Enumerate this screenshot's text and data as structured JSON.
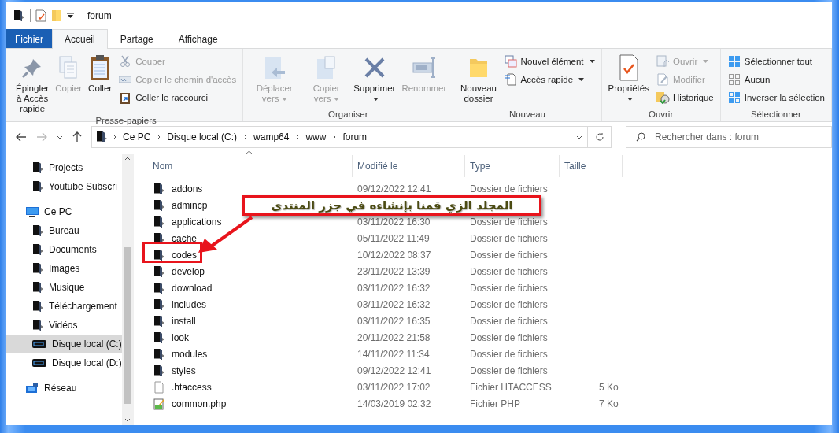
{
  "window": {
    "title": "forum"
  },
  "ribbon_tabs": [
    {
      "label": "Fichier",
      "kind": "file",
      "selected": false
    },
    {
      "label": "Accueil",
      "kind": "tab",
      "selected": true
    },
    {
      "label": "Partage",
      "kind": "tab",
      "selected": false
    },
    {
      "label": "Affichage",
      "kind": "tab",
      "selected": false
    }
  ],
  "ribbon_groups": [
    {
      "title": "Presse-papiers",
      "commands": [
        {
          "kind": "large",
          "label": "Épingler à Accès rapide",
          "disabled": false,
          "dropdown": false
        },
        {
          "kind": "large",
          "label": "Copier",
          "disabled": true,
          "dropdown": false
        },
        {
          "kind": "large",
          "label": "Coller",
          "disabled": false,
          "dropdown": false
        },
        {
          "kind": "stack",
          "items": [
            {
              "label": "Couper",
              "disabled": true,
              "dropdown": false
            },
            {
              "label": "Copier le chemin d'accès",
              "disabled": true,
              "dropdown": false
            },
            {
              "label": "Coller le raccourci",
              "disabled": false,
              "dropdown": false
            }
          ]
        }
      ]
    },
    {
      "title": "Organiser",
      "commands": [
        {
          "kind": "large",
          "label": "Déplacer vers",
          "disabled": true,
          "dropdown": true
        },
        {
          "kind": "large",
          "label": "Copier vers",
          "disabled": true,
          "dropdown": true
        },
        {
          "kind": "large",
          "label": "Supprimer",
          "disabled": false,
          "dropdown": true
        },
        {
          "kind": "large",
          "label": "Renommer",
          "disabled": true,
          "dropdown": false
        }
      ]
    },
    {
      "title": "Nouveau",
      "commands": [
        {
          "kind": "large",
          "label": "Nouveau dossier",
          "disabled": false,
          "dropdown": false
        },
        {
          "kind": "stack",
          "items": [
            {
              "label": "Nouvel élément",
              "disabled": false,
              "dropdown": true
            },
            {
              "label": "Accès rapide",
              "disabled": false,
              "dropdown": true
            }
          ]
        }
      ]
    },
    {
      "title": "Ouvrir",
      "commands": [
        {
          "kind": "large",
          "label": "Propriétés",
          "disabled": false,
          "dropdown": true
        },
        {
          "kind": "stack",
          "items": [
            {
              "label": "Ouvrir",
              "disabled": true,
              "dropdown": true
            },
            {
              "label": "Modifier",
              "disabled": true,
              "dropdown": false
            },
            {
              "label": "Historique",
              "disabled": false,
              "dropdown": false
            }
          ]
        }
      ]
    },
    {
      "title": "Sélectionner",
      "commands": [
        {
          "kind": "stack",
          "items": [
            {
              "label": "Sélectionner tout",
              "disabled": false,
              "dropdown": false
            },
            {
              "label": "Aucun",
              "disabled": false,
              "dropdown": false
            },
            {
              "label": "Inverser la sélection",
              "disabled": false,
              "dropdown": false
            }
          ]
        }
      ]
    }
  ],
  "address_bar": {
    "path": [
      "Ce PC",
      "Disque local (C:)",
      "wamp64",
      "www",
      "forum"
    ]
  },
  "search": {
    "placeholder": "Rechercher dans : forum"
  },
  "nav": {
    "pinned": [
      {
        "label": "Projects",
        "kind": "folder",
        "selected": false
      },
      {
        "label": "Youtube Subscri",
        "kind": "folder",
        "selected": false
      }
    ],
    "tree": [
      {
        "label": "Ce PC",
        "kind": "pc",
        "selected": false,
        "children": [
          {
            "label": "Bureau",
            "kind": "folder",
            "selected": false
          },
          {
            "label": "Documents",
            "kind": "folder",
            "selected": false
          },
          {
            "label": "Images",
            "kind": "folder",
            "selected": false
          },
          {
            "label": "Musique",
            "kind": "folder",
            "selected": false
          },
          {
            "label": "Téléchargement",
            "kind": "folder",
            "selected": false
          },
          {
            "label": "Vidéos",
            "kind": "folder",
            "selected": false
          },
          {
            "label": "Disque local (C:)",
            "kind": "drive",
            "selected": true
          },
          {
            "label": "Disque local (D:)",
            "kind": "drive",
            "selected": false
          }
        ]
      },
      {
        "label": "Réseau",
        "kind": "network",
        "selected": false
      }
    ]
  },
  "table": {
    "columns": [
      {
        "label": "Nom",
        "sorted": true
      },
      {
        "label": "Modifié le",
        "sorted": false
      },
      {
        "label": "Type",
        "sorted": false
      },
      {
        "label": "Taille",
        "sorted": false
      }
    ],
    "rows": [
      {
        "kind": "folder",
        "name": "addons",
        "modified": "09/12/2022 12:41",
        "type": "Dossier de fichiers",
        "highlighted": false
      },
      {
        "kind": "folder",
        "name": "admincp",
        "highlighted": false
      },
      {
        "kind": "folder",
        "name": "applications",
        "modified": "03/11/2022 16:30",
        "type": "Dossier de fichiers",
        "highlighted": false
      },
      {
        "kind": "folder",
        "name": "cache",
        "modified": "05/11/2022 11:49",
        "type": "Dossier de fichiers",
        "highlighted": false
      },
      {
        "kind": "folder",
        "name": "codes",
        "modified": "10/12/2022 08:37",
        "type": "Dossier de fichiers",
        "highlighted": true
      },
      {
        "kind": "folder",
        "name": "develop",
        "modified": "23/11/2022 13:39",
        "type": "Dossier de fichiers",
        "highlighted": false
      },
      {
        "kind": "folder",
        "name": "download",
        "modified": "03/11/2022 16:32",
        "type": "Dossier de fichiers",
        "highlighted": false
      },
      {
        "kind": "folder",
        "name": "includes",
        "modified": "03/11/2022 16:32",
        "type": "Dossier de fichiers",
        "highlighted": false
      },
      {
        "kind": "folder",
        "name": "install",
        "modified": "03/11/2022 16:35",
        "type": "Dossier de fichiers",
        "highlighted": false
      },
      {
        "kind": "folder",
        "name": "look",
        "modified": "20/11/2022 21:58",
        "type": "Dossier de fichiers",
        "highlighted": false
      },
      {
        "kind": "folder",
        "name": "modules",
        "modified": "14/11/2022 11:34",
        "type": "Dossier de fichiers",
        "highlighted": false
      },
      {
        "kind": "folder",
        "name": "styles",
        "modified": "09/12/2022 12:41",
        "type": "Dossier de fichiers",
        "highlighted": false
      },
      {
        "kind": "file",
        "name": ".htaccess",
        "modified": "03/11/2022 17:02",
        "type": "Fichier HTACCESS",
        "size": "5 Ko",
        "highlighted": false
      },
      {
        "kind": "script",
        "name": "common.php",
        "modified": "14/03/2019 02:32",
        "type": "Fichier PHP",
        "size": "7 Ko",
        "highlighted": false
      }
    ]
  },
  "annotation": {
    "text": "المجلد الزي قمنا بإنشاءه في جزر المنتدى"
  }
}
